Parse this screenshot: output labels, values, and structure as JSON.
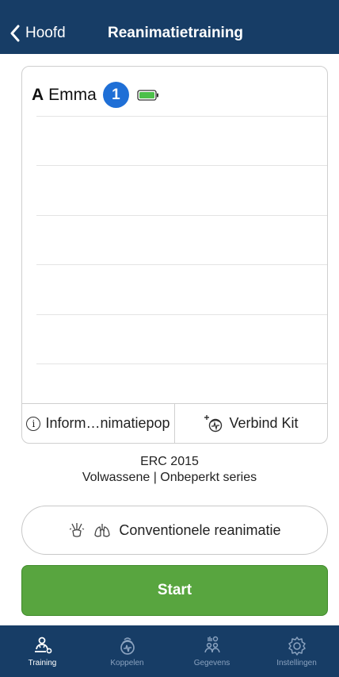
{
  "header": {
    "back_label": "Hoofd",
    "title": "Reanimatietraining"
  },
  "student": {
    "letter": "A",
    "name": "Emma",
    "number": "1",
    "battery_icon": "battery-full-icon"
  },
  "card_footer": {
    "info_label": "Inform…nimatiepop",
    "connect_label": "Verbind Kit"
  },
  "protocol": {
    "guideline": "ERC 2015",
    "settings": "Volwassene | Onbeperkt series"
  },
  "mode_button": {
    "label": "Conventionele reanimatie"
  },
  "start_button": {
    "label": "Start"
  },
  "tabs": [
    {
      "label": "Training",
      "icon": "training-icon",
      "active": true
    },
    {
      "label": "Koppelen",
      "icon": "connect-icon",
      "active": false
    },
    {
      "label": "Gegevens",
      "icon": "data-icon",
      "active": false
    },
    {
      "label": "Instellingen",
      "icon": "settings-icon",
      "active": false
    }
  ],
  "colors": {
    "header": "#173d66",
    "accent_blue": "#1f6fd6",
    "start_green": "#58a53f",
    "battery_green": "#4cc04a"
  }
}
